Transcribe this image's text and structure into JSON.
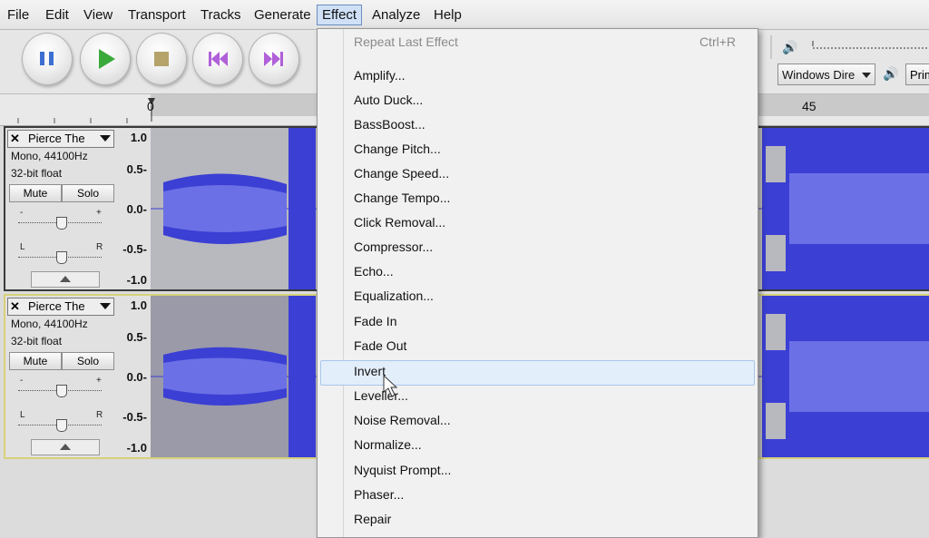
{
  "menubar": {
    "items": [
      "File",
      "Edit",
      "View",
      "Transport",
      "Tracks",
      "Generate",
      "Effect",
      "Analyze",
      "Help"
    ],
    "active": "Effect"
  },
  "toolbar": {
    "buttons": [
      "pause-icon",
      "play-icon",
      "stop-icon",
      "skip-to-start-icon",
      "skip-to-end-icon"
    ],
    "output_device": "Windows Dire",
    "output_device2": "Prim",
    "colors": {
      "pause": "#3c6fd0",
      "play": "#3aaa3a",
      "stop": "#b5a36a",
      "skip": "#b060d8"
    }
  },
  "timeline": {
    "labels": [
      "0",
      "45"
    ]
  },
  "tracks": [
    {
      "name": "Pierce The",
      "info1": "Mono, 44100Hz",
      "info2": "32-bit float",
      "mute": "Mute",
      "solo": "Solo",
      "gain_min": "-",
      "gain_max": "+",
      "pan_left": "L",
      "pan_right": "R",
      "scale": [
        "1.0",
        "0.5-",
        "0.0-",
        "-0.5-",
        "-1.0"
      ]
    },
    {
      "name": "Pierce The",
      "info1": "Mono, 44100Hz",
      "info2": "32-bit float",
      "mute": "Mute",
      "solo": "Solo",
      "gain_min": "-",
      "gain_max": "+",
      "pan_left": "L",
      "pan_right": "R",
      "scale": [
        "1.0",
        "0.5-",
        "0.0-",
        "-0.5-",
        "-1.0"
      ]
    }
  ],
  "effect_menu": {
    "repeat": {
      "label": "Repeat Last Effect",
      "shortcut": "Ctrl+R"
    },
    "items": [
      "Amplify...",
      "Auto Duck...",
      "BassBoost...",
      "Change Pitch...",
      "Change Speed...",
      "Change Tempo...",
      "Click Removal...",
      "Compressor...",
      "Echo...",
      "Equalization...",
      "Fade In",
      "Fade Out",
      "Invert",
      "Leveller...",
      "Noise Removal...",
      "Normalize...",
      "Nyquist Prompt...",
      "Phaser...",
      "Repair"
    ],
    "highlighted": "Invert"
  },
  "colors": {
    "wave": "#3b3fd4",
    "wave_bg": "#c8c8c8",
    "selected_bg": "#9a9aa8"
  }
}
